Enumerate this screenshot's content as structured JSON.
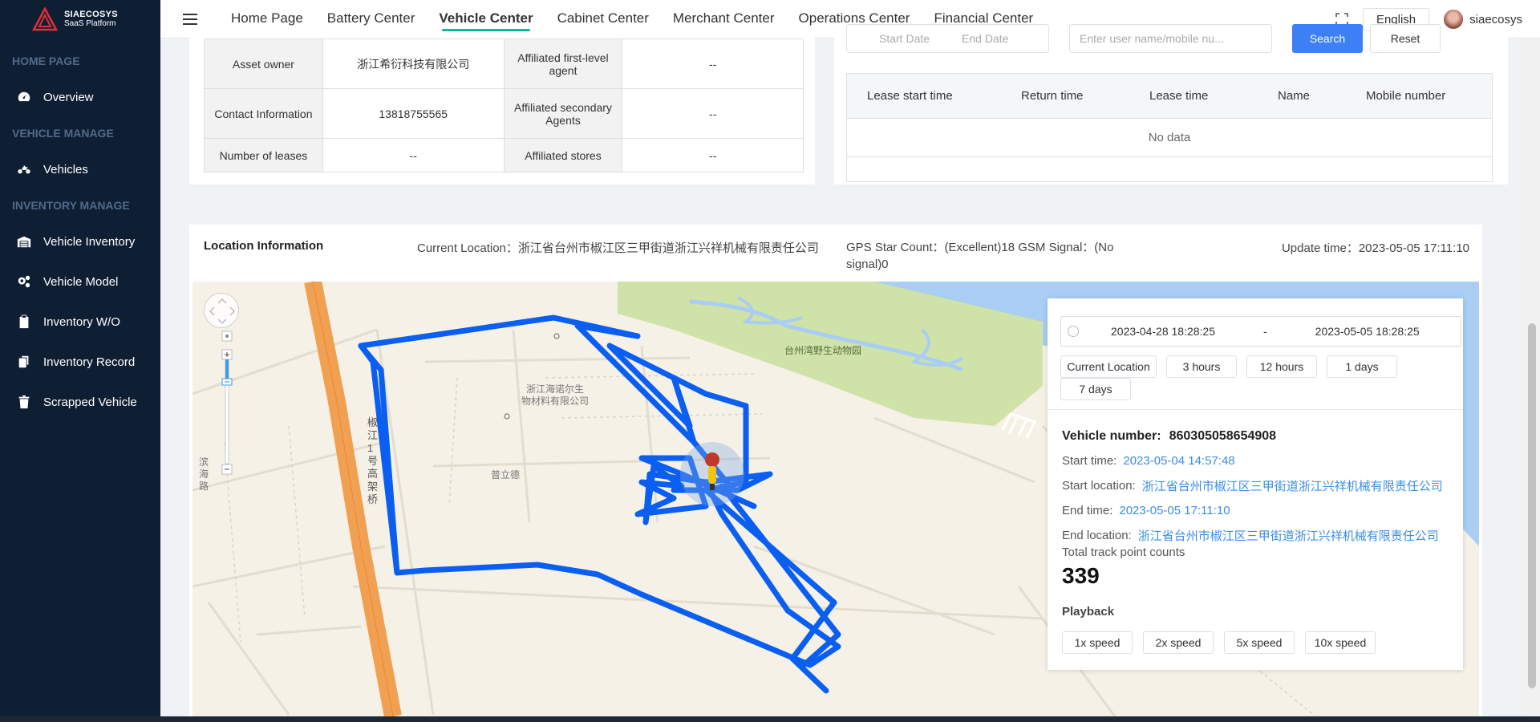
{
  "brand": {
    "name": "SIAECOSYS",
    "sub": "SaaS Platform"
  },
  "sidebar": {
    "sections": [
      {
        "title": "HOME PAGE",
        "items": [
          {
            "label": "Overview",
            "icon": "dashboard-icon"
          }
        ]
      },
      {
        "title": "VEHICLE MANAGE",
        "items": [
          {
            "label": "Vehicles",
            "icon": "motorcycle-icon"
          }
        ]
      },
      {
        "title": "INVENTORY MANAGE",
        "items": [
          {
            "label": "Vehicle Inventory",
            "icon": "warehouse-icon"
          },
          {
            "label": "Vehicle Model",
            "icon": "gears-icon"
          },
          {
            "label": "Inventory W/O",
            "icon": "clipboard-icon"
          },
          {
            "label": "Inventory Record",
            "icon": "copy-icon"
          },
          {
            "label": "Scrapped Vehicle",
            "icon": "trash-icon"
          }
        ]
      }
    ]
  },
  "topnav": {
    "tabs": [
      "Home Page",
      "Battery Center",
      "Vehicle Center",
      "Cabinet Center",
      "Merchant Center",
      "Operations Center",
      "Financial Center"
    ],
    "active": "Vehicle Center",
    "language": "English",
    "username": "siaecosys"
  },
  "info": {
    "rows": [
      {
        "l1": "Asset owner",
        "v1": "浙江希衍科技有限公司",
        "l2": "Affiliated first-level agent",
        "v2": "--"
      },
      {
        "l1": "Contact Information",
        "v1": "13818755565",
        "l2": "Affiliated secondary Agents",
        "v2": "--"
      },
      {
        "l1": "Number of leases",
        "v1": "--",
        "l2": "Affiliated stores",
        "v2": "--"
      }
    ]
  },
  "lease": {
    "start_placeholder": "Start Date",
    "end_placeholder": "End Date",
    "user_placeholder": "Enter user name/mobile nu...",
    "search_label": "Search",
    "reset_label": "Reset",
    "columns": [
      "Lease start time",
      "Return time",
      "Lease time",
      "Name",
      "Mobile number"
    ],
    "empty_text": "No data"
  },
  "location": {
    "title": "Location Information",
    "current": "Current Location：浙江省台州市椒江区三甲街道浙江兴祥机械有限责任公司",
    "gps": "GPS Star Count：(Excellent)18   GSM Signal：(No signal)0",
    "update": "Update time：2023-05-05 17:11:10"
  },
  "map": {
    "labels": {
      "zoo": "台州湾野生动物园",
      "company_line1": "浙江海诺尔生",
      "company_line2": "物材料有限公司",
      "puli": "普立德",
      "binhai": "滨海路",
      "bridge": "椒江1号高架桥"
    }
  },
  "track": {
    "range_start": "2023-04-28 18:28:25",
    "range_sep": "-",
    "range_end": "2023-05-05 18:28:25",
    "quick": [
      "Current Location",
      "3 hours",
      "12 hours",
      "1 days",
      "7 days"
    ],
    "vehicle_label": "Vehicle number:",
    "vehicle_number": "860305058654908",
    "start_time_label": "Start time:",
    "start_time": "2023-05-04 14:57:48",
    "start_loc_label": "Start location:",
    "start_loc": "浙江省台州市椒江区三甲街道浙江兴祥机械有限责任公司",
    "end_time_label": "End time:",
    "end_time": "2023-05-05 17:11:10",
    "end_loc_label": "End location:",
    "end_loc": "浙江省台州市椒江区三甲街道浙江兴祥机械有限责任公司",
    "total_label": "Total track point counts",
    "total": "339",
    "playback_label": "Playback",
    "speeds": [
      "1x speed",
      "2x speed",
      "5x speed",
      "10x speed"
    ]
  },
  "colors": {
    "sidebar": "#0f1f33",
    "accent": "#13b4a3",
    "primary": "#3d7ff5",
    "track": "#0a5ff0",
    "link": "#3a8ee6"
  }
}
